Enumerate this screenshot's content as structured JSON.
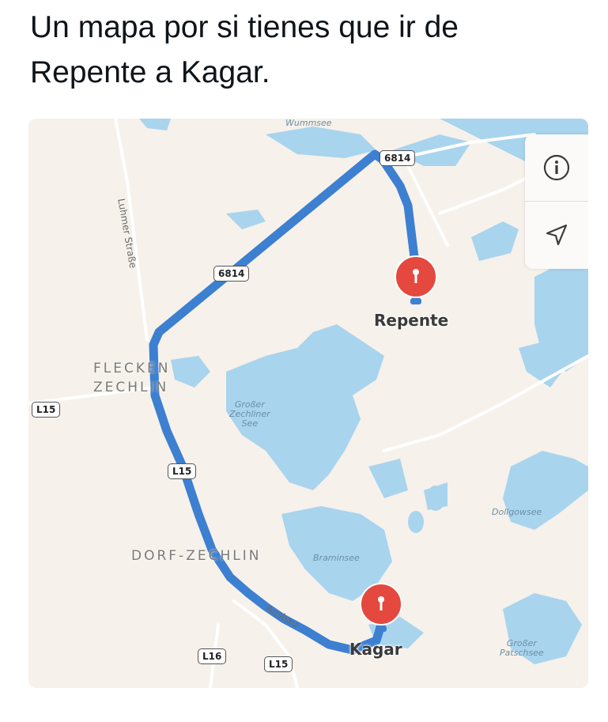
{
  "post": {
    "text": "Un mapa por si tienes que ir de Repente a Kagar."
  },
  "map": {
    "places": {
      "repente": "Repente",
      "kagar": "Kagar"
    },
    "towns": {
      "flecken_line1": "FLECKEN",
      "flecken_line2": "ZECHLIN",
      "dorf": "DORF-ZECHLIN"
    },
    "water": {
      "wummsee": "Wummsee",
      "grosser_zechliner_1": "Großer",
      "grosser_zechliner_2": "Zechliner",
      "grosser_zechliner_3": "See",
      "braminsee": "Braminsee",
      "dollgowsee": "Dollgowsee",
      "patschsee_1": "Großer",
      "patschsee_2": "Patschsee"
    },
    "streets": {
      "luhmer": "Luhmer Straße",
      "ausbau": "Ausbau"
    },
    "route_shields": {
      "top": "6814",
      "middle": "6814",
      "l15_left": "L15",
      "l15_route": "L15",
      "l16": "L16",
      "l15_bottom": "L15"
    },
    "controls": {
      "info_icon": "info-icon",
      "locate_icon": "location-arrow-icon"
    },
    "colors": {
      "route": "#3d7fd1",
      "pin": "#e4483f",
      "water": "#a8d4ee",
      "land": "#f6f1ea"
    }
  }
}
